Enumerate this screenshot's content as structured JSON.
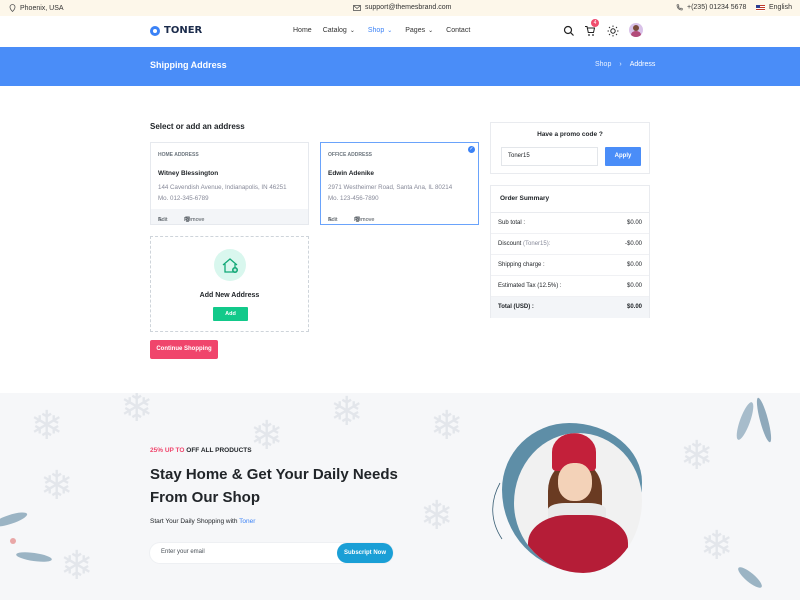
{
  "topbar": {
    "location": "Phoenix, USA",
    "email": "support@themesbrand.com",
    "phone": "+(235) 01234 5678",
    "language": "English"
  },
  "nav": {
    "brand": "TONER",
    "menu": [
      {
        "label": "Home",
        "has_dropdown": false,
        "active": false
      },
      {
        "label": "Catalog",
        "has_dropdown": true,
        "active": false
      },
      {
        "label": "Shop",
        "has_dropdown": true,
        "active": true
      },
      {
        "label": "Pages",
        "has_dropdown": true,
        "active": false
      },
      {
        "label": "Contact",
        "has_dropdown": false,
        "active": false
      }
    ],
    "cart_count": "4",
    "icons": [
      "search-icon",
      "cart-icon",
      "theme-toggle-icon",
      "avatar"
    ]
  },
  "banner": {
    "title": "Shipping Address",
    "breadcrumb": [
      "Shop",
      "Address"
    ]
  },
  "address_section": {
    "title": "Select or add an address",
    "addresses": [
      {
        "type": "HOME ADDRESS",
        "name": "Witney Blessington",
        "line1": "144 Cavendish Avenue, Indianapolis, IN 46251",
        "phone": "Mo. 012-345-6789",
        "selected": false
      },
      {
        "type": "OFFICE ADDRESS",
        "name": "Edwin Adenike",
        "line1": "2971 Westheimer Road, Santa Ana, IL 80214",
        "phone": "Mo. 123-456-7890",
        "selected": true
      }
    ],
    "edit_label": "Edit",
    "remove_label": "Remove",
    "new_address_label": "Add New Address",
    "add_button": "Add",
    "continue_button": "Continue Shopping"
  },
  "promo_code": {
    "title": "Have a promo code ?",
    "value": "Toner15",
    "apply_button": "Apply"
  },
  "order_summary": {
    "title": "Order Summary",
    "rows": [
      {
        "label": "Sub total :",
        "note": "",
        "value": "$0.00"
      },
      {
        "label": "Discount ",
        "note": "(Toner15):",
        "value": "-$0.00"
      },
      {
        "label": "Shipping charge :",
        "note": "",
        "value": "$0.00"
      },
      {
        "label": "Estimated Tax (12.5%) :",
        "note": "",
        "value": "$0.00"
      },
      {
        "label": "Total (USD) :",
        "note": "",
        "value": "$0.00"
      }
    ]
  },
  "promo_section": {
    "tag_highlight": "25% UP TO",
    "tag_rest": " OFF ALL PRODUCTS",
    "headline": "Stay Home & Get Your Daily Needs From Our Shop",
    "sub_prefix": "Start Your Daily Shopping with ",
    "sub_brand": "Toner",
    "email_placeholder": "Enter your email",
    "subscribe_button": "Subscript Now"
  },
  "colors": {
    "primary": "#4a8df8",
    "accent_pink": "#f0456c",
    "success": "#12c98a",
    "subscribe": "#1a9fd6"
  }
}
